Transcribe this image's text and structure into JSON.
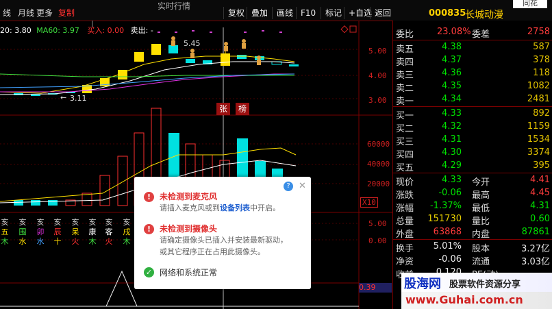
{
  "topbar": {
    "left_items": [
      "线",
      "月线",
      "更多"
    ],
    "left_tab_active": "复制",
    "stock_header": "实时行情",
    "buttons": [
      "复权",
      "叠加",
      "画线",
      "F10",
      "标记",
      "+自选",
      "返回"
    ],
    "stock_code": "000835",
    "stock_name": "长城动漫",
    "right_trunc": "同花"
  },
  "chart": {
    "ma_legend": [
      {
        "text": "20: 3.80",
        "color": "#ffffff"
      },
      {
        "text": "MA60: 3.97",
        "color": "#40e040"
      },
      {
        "text": "买入: 0.00",
        "color": "#ff3030"
      },
      {
        "text": "卖出: -",
        "color": "#ffffff"
      }
    ],
    "price_axis": [
      "5.00",
      "4.00",
      "3.00"
    ],
    "high_label": "5.45",
    "low_label": "3.11",
    "volume_axis": [
      "60000",
      "40000",
      "20000"
    ],
    "vol_unit": "X10",
    "zt_label": "张",
    "bang_label": "榜",
    "ind_axis_1": "5.00",
    "ind_axis_2": "0.00",
    "value_box": "0.39",
    "cn_columns": [
      [
        "亥",
        "五",
        "木"
      ],
      [
        "亥",
        "围",
        "水"
      ],
      [
        "亥",
        "卯",
        "水"
      ],
      [
        "亥",
        "辰",
        "十"
      ],
      [
        "亥",
        "呆",
        "火"
      ],
      [
        "亥",
        "康",
        "木"
      ],
      [
        "亥",
        "客",
        "火"
      ],
      [
        "亥",
        "戌",
        "木"
      ]
    ]
  },
  "panel": {
    "weibi_label": "委比",
    "weibi_value": "23.08%",
    "weicha_label": "委差",
    "weicha_value": "2758",
    "sell": [
      {
        "label": "卖五",
        "price": "4.38",
        "vol": "587"
      },
      {
        "label": "卖四",
        "price": "4.37",
        "vol": "378"
      },
      {
        "label": "卖三",
        "price": "4.36",
        "vol": "118"
      },
      {
        "label": "卖二",
        "price": "4.35",
        "vol": "1082"
      },
      {
        "label": "卖一",
        "price": "4.34",
        "vol": "2481"
      }
    ],
    "buy": [
      {
        "label": "买一",
        "price": "4.33",
        "vol": "892"
      },
      {
        "label": "买二",
        "price": "4.32",
        "vol": "1159"
      },
      {
        "label": "买三",
        "price": "4.31",
        "vol": "1534"
      },
      {
        "label": "买四",
        "price": "4.30",
        "vol": "3374"
      },
      {
        "label": "买五",
        "price": "4.29",
        "vol": "395"
      }
    ],
    "stats": [
      {
        "l1": "现价",
        "v1": "4.33",
        "c1": "green",
        "l2": "今开",
        "v2": "4.41",
        "c2": "red"
      },
      {
        "l1": "涨跌",
        "v1": "-0.06",
        "c1": "green",
        "l2": "最高",
        "v2": "4.45",
        "c2": "red"
      },
      {
        "l1": "涨幅",
        "v1": "-1.37%",
        "c1": "green",
        "l2": "最低",
        "v2": "4.31",
        "c2": "green"
      },
      {
        "l1": "总量",
        "v1": "151730",
        "c1": "yellow",
        "l2": "量比",
        "v2": "0.60",
        "c2": "green"
      },
      {
        "l1": "外盘",
        "v1": "63868",
        "c1": "red",
        "l2": "内盘",
        "v2": "87861",
        "c2": "green"
      }
    ],
    "stats2": [
      {
        "l1": "换手",
        "v1": "5.01%",
        "c1": "white",
        "l2": "股本",
        "v2": "3.27亿",
        "c2": "white"
      },
      {
        "l1": "净资",
        "v1": "-0.06",
        "c1": "white",
        "l2": "流通",
        "v2": "3.03亿",
        "c2": "white"
      },
      {
        "l1": "收益",
        "v1": "0.120",
        "c1": "white",
        "l2": "PE(动)",
        "v2": "",
        "c2": "white"
      }
    ]
  },
  "popup": {
    "mic_title": "未检测到麦克风",
    "mic_text_pre": "请插入麦克风或到",
    "mic_link": "设备列表",
    "mic_text_post": "中开启。",
    "cam_title": "未检测到摄像头",
    "cam_text_1": "请确定摄像头已插入并安装最新驱动，",
    "cam_text_2": "或其它程序正在占用此摄像头。",
    "net_text": "网络和系统正常",
    "help": "?",
    "close": "✕"
  },
  "watermark": {
    "line1": "股海网",
    "line2": "股票软件资源分享",
    "url": "www.Guhai.com.cn"
  },
  "colors": {
    "up": "#ff3030",
    "down": "#00e0e0",
    "bg": "#000000"
  }
}
